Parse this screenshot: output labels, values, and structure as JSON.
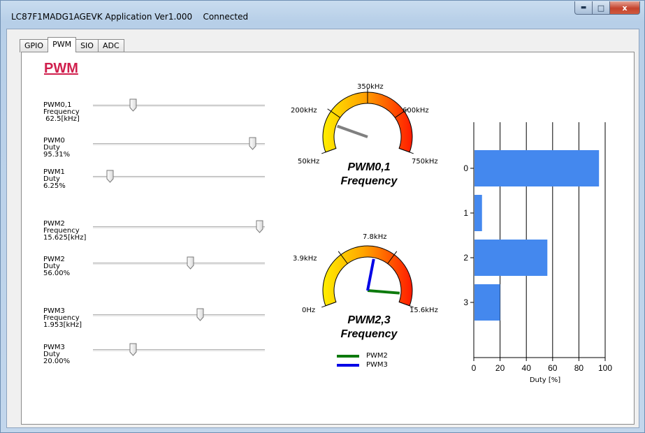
{
  "window": {
    "title": "LC87F1MADG1AGEVK Application Ver1.000    Connected",
    "min_glyph": "▬",
    "max_glyph": "□",
    "close_glyph": "x"
  },
  "tabs": [
    {
      "label": "GPIO",
      "active": false
    },
    {
      "label": "PWM",
      "active": true
    },
    {
      "label": "SIO",
      "active": false
    },
    {
      "label": "ADC",
      "active": false
    }
  ],
  "heading": "PWM",
  "sliders": [
    {
      "lines": [
        "PWM0,1",
        "Frequency",
        " 62.5[kHz]"
      ],
      "level": 0.22
    },
    {
      "lines": [
        "PWM0",
        "Duty",
        "95.31%"
      ],
      "level": 0.95
    },
    {
      "lines": [
        "PWM1",
        "Duty",
        "6.25%"
      ],
      "level": 0.08
    },
    {
      "lines": [
        "PWM2",
        "Frequency",
        "15.625[kHz]"
      ],
      "level": 0.99
    },
    {
      "lines": [
        "PWM2",
        "Duty",
        "56.00%"
      ],
      "level": 0.57
    },
    {
      "lines": [
        "PWM3",
        "Frequency",
        "1.953[kHz]"
      ],
      "level": 0.63
    },
    {
      "lines": [
        "PWM3",
        "Duty",
        "20.00%"
      ],
      "level": 0.22
    }
  ],
  "gauge1": {
    "ticks": [
      "50kHz",
      "200kHz",
      "350kHz",
      "600kHz",
      "750kHz"
    ],
    "title_line1": "PWM0,1",
    "title_line2": "Frequency",
    "needle_level": 0.18,
    "needle_color": "#808080"
  },
  "gauge2": {
    "ticks": [
      "0Hz",
      "3.9kHz",
      "7.8kHz",
      "15.6kHz"
    ],
    "title_line1": "PWM2,3",
    "title_line2": "Frequency",
    "needles": [
      {
        "name": "PWM2",
        "level": 0.93,
        "color": "#0d7a0d"
      },
      {
        "name": "PWM3",
        "level": 0.55,
        "color": "#0000e6"
      }
    ]
  },
  "legend": [
    {
      "name": "PWM2",
      "color": "#0d7a0d"
    },
    {
      "name": "PWM3",
      "color": "#0000e6"
    }
  ],
  "chart_data": {
    "type": "bar",
    "orientation": "horizontal",
    "categories": [
      "0",
      "1",
      "2",
      "3"
    ],
    "values": [
      95.31,
      6.25,
      56.0,
      20.0
    ],
    "xlim": [
      0,
      100
    ],
    "xticks": [
      "0",
      "20",
      "40",
      "60",
      "80",
      "100"
    ],
    "xlabel": "Duty [%]",
    "bar_color": "#4488ee",
    "grid": "vertical"
  }
}
